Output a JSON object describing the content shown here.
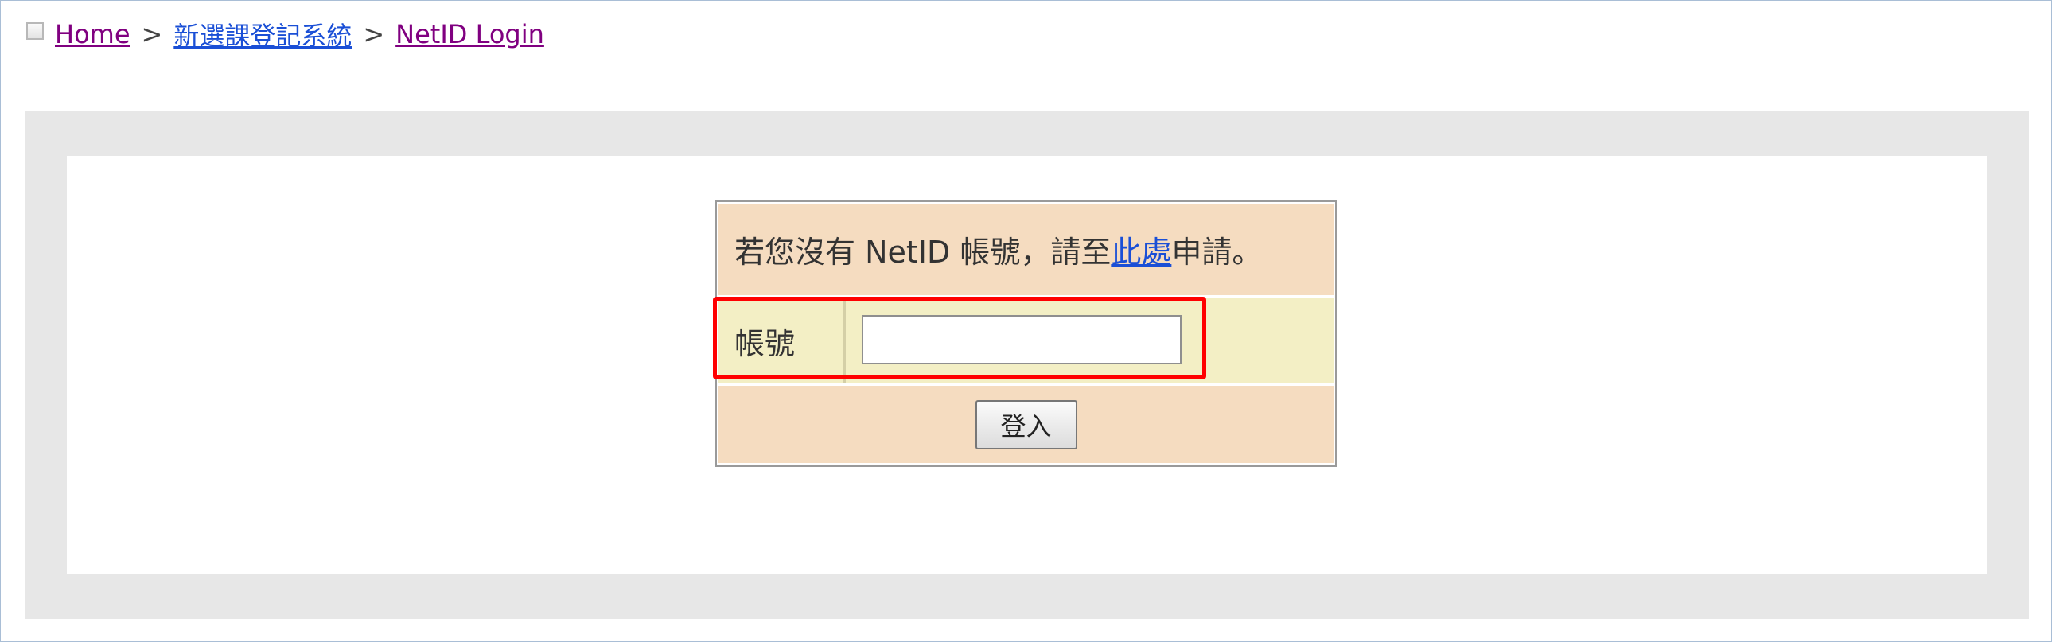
{
  "breadcrumb": {
    "home": "Home",
    "separator_1": ">",
    "system": "新選課登記系統",
    "separator_2": ">",
    "current": "NetID Login"
  },
  "login": {
    "info_prefix": "若您沒有 NetID 帳號，請至",
    "info_link": "此處",
    "info_suffix": "申請。",
    "account_label": "帳號",
    "account_value": "",
    "submit_label": "登入"
  },
  "colors": {
    "info_row_bg": "#f5dcc0",
    "account_row_bg": "#f3efc5",
    "highlight": "#ff0000",
    "outer_panel_bg": "#e7e7e7"
  }
}
